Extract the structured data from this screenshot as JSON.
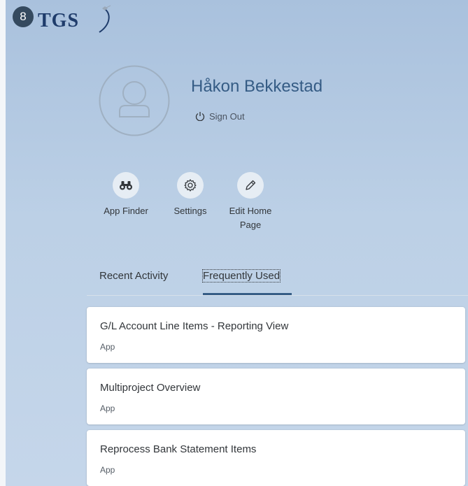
{
  "header": {
    "badge": "8",
    "logo_text": "TGS"
  },
  "user": {
    "name": "Håkon Bekkestad",
    "sign_out_label": "Sign Out"
  },
  "actions": [
    {
      "label": "App Finder",
      "icon": "binoculars-icon"
    },
    {
      "label": "Settings",
      "icon": "gear-icon"
    },
    {
      "label": "Edit Home Page",
      "icon": "pencil-icon"
    }
  ],
  "tabs": [
    {
      "label": "Recent Activity",
      "selected": false
    },
    {
      "label": "Frequently Used",
      "selected": true
    }
  ],
  "list": [
    {
      "title": "G/L Account Line Items - Reporting View",
      "type": "App"
    },
    {
      "title": "Multiproject Overview",
      "type": "App"
    },
    {
      "title": "Reprocess Bank Statement Items",
      "type": "App"
    }
  ],
  "colors": {
    "accent": "#355c85",
    "badge": "#354a5f",
    "logo": "#1f3c6b"
  }
}
